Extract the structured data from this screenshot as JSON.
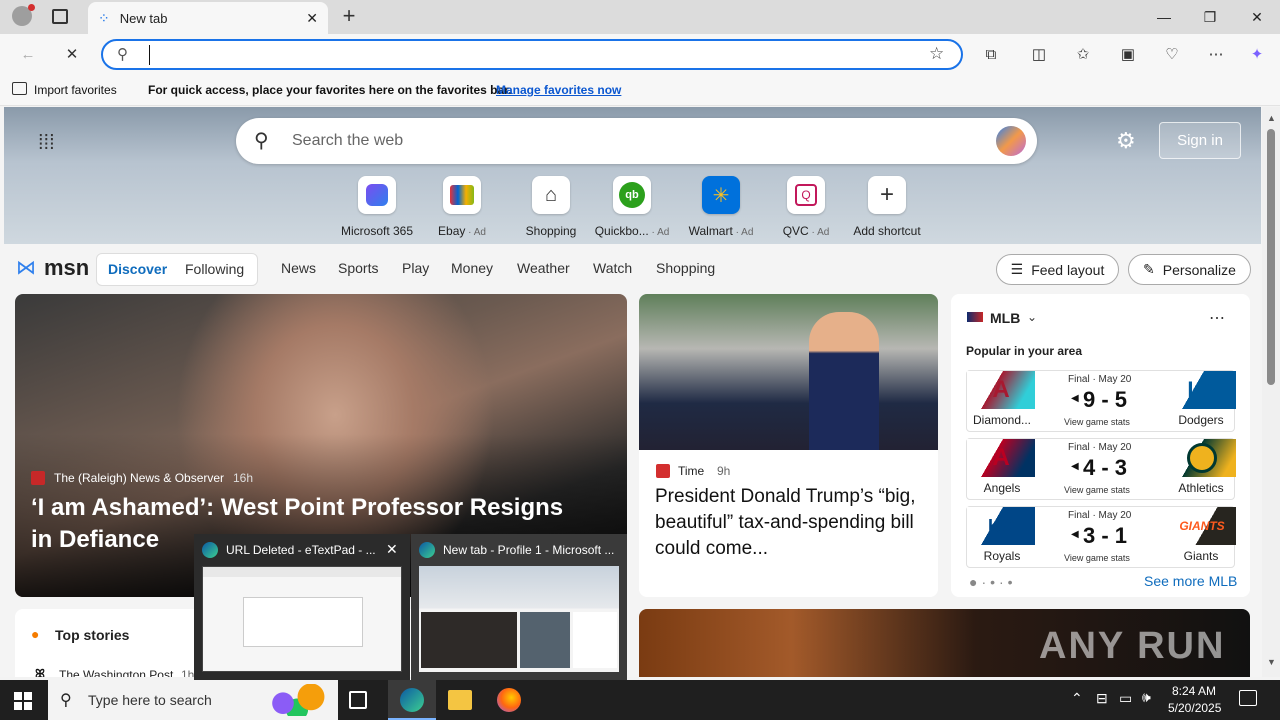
{
  "browser": {
    "tab_title": "New tab",
    "address_value": "",
    "favbar": {
      "import_label": "Import favorites",
      "message": "For quick access, place your favorites here on the favorites bar.",
      "manage_link": "Manage favorites now"
    }
  },
  "newtab": {
    "search_placeholder": "Search the web",
    "sign_in": "Sign in",
    "quick_links": [
      {
        "label": "Microsoft 365",
        "ad": ""
      },
      {
        "label": "Ebay",
        "ad": "Ad"
      },
      {
        "label": "Shopping",
        "ad": ""
      },
      {
        "label": "Quickbo...",
        "ad": "Ad"
      },
      {
        "label": "Walmart",
        "ad": "Ad"
      },
      {
        "label": "QVC",
        "ad": "Ad"
      },
      {
        "label": "Add shortcut",
        "ad": ""
      }
    ]
  },
  "msn": {
    "logo": "msn",
    "tabs": [
      "Discover",
      "Following"
    ],
    "nav": [
      "News",
      "Sports",
      "Play",
      "Money",
      "Weather",
      "Watch",
      "Shopping"
    ],
    "feed_layout": "Feed layout",
    "personalize": "Personalize"
  },
  "hero_story": {
    "source": "The (Raleigh) News & Observer",
    "age": "16h",
    "headline": "‘I am Ashamed’: West Point Professor Resigns in Defiance"
  },
  "second_story": {
    "source": "Time",
    "age": "9h",
    "headline": "President Donald Trump’s “big, beautiful” tax-and-spending bill could come..."
  },
  "mlb": {
    "title": "MLB",
    "subtitle": "Popular in your area",
    "games": [
      {
        "status": "Final · May 20",
        "score": "9 - 5",
        "home": "Diamond...",
        "away": "Dodgers",
        "stats": "View game stats"
      },
      {
        "status": "Final · May 20",
        "score": "4 - 3",
        "home": "Angels",
        "away": "Athletics",
        "stats": "View game stats"
      },
      {
        "status": "Final · May 20",
        "score": "3 - 1",
        "home": "Royals",
        "away": "Giants",
        "stats": "View game stats"
      }
    ],
    "see_more": "See more MLB"
  },
  "top_stories": {
    "title": "Top stories",
    "first_source": "The Washington Post",
    "first_age": "1h"
  },
  "thumbnails": [
    {
      "title": "URL Deleted - eTextPad - ..."
    },
    {
      "title": "New tab - Profile 1 - Microsoft ..."
    }
  ],
  "taskbar": {
    "search_placeholder": "Type here to search",
    "time": "8:24 AM",
    "date": "5/20/2025"
  },
  "watermark": "ANY RUN"
}
